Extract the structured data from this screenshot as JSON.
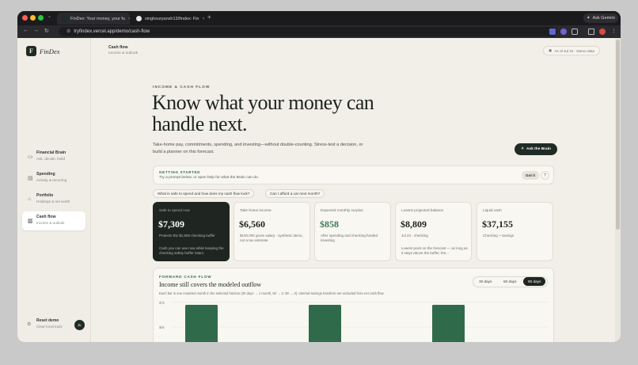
{
  "browser": {
    "tabs": [
      {
        "title": "FinDex: Your money, your fu",
        "active": true
      },
      {
        "title": "singhsuryansh13/findex: Fin",
        "active": false
      }
    ],
    "new_tab": "+",
    "ask_gemini": "Ask Gemini",
    "url": "tryfindex.vercel.app/demo/cash-flow"
  },
  "app": {
    "logo_letter": "F",
    "logo_name": "FinDex",
    "nav": [
      {
        "title": "Financial Brain",
        "subtitle": "Ask, decide, build",
        "icon": "briefcase-icon"
      },
      {
        "title": "Spending",
        "subtitle": "Activity & recurring",
        "icon": "receipt-icon"
      },
      {
        "title": "Portfolio",
        "subtitle": "Holdings & net worth",
        "icon": "bank-icon"
      },
      {
        "title": "Cash flow",
        "subtitle": "Income & outlook",
        "icon": "bar-chart-icon",
        "active": true
      }
    ],
    "reset": {
      "title": "Reset demo",
      "subtitle": "Clear local tools"
    },
    "avatar": "JL"
  },
  "header": {
    "title": "Cash flow",
    "subtitle": "Income & outlook",
    "as_of": "As of Jul 31 · Demo data"
  },
  "hero": {
    "eyebrow": "INCOME & CASH FLOW",
    "headline": "Know what your money can handle next.",
    "lede": "Take-home pay, commitments, spending, and investing—without double-counting. Stress-test a decision, or build a planner on this forecast.",
    "ask_brain": "Ask the Brain"
  },
  "getting_started": {
    "heading": "GETTING STARTED",
    "text": "Try a prompt below, or open help for what the Brain can do.",
    "got_it": "Got it",
    "help": "?"
  },
  "prompts": [
    "What is safe to spend and how does my cash flow look?",
    "Can I afford a car next month?"
  ],
  "cards": [
    {
      "label": "Safe to spend now",
      "value": "$7,309",
      "sub": "Protects the $1,500 checking buffer",
      "sub2": "Cash you can use now while keeping the checking safety buffer intact.",
      "dark": true
    },
    {
      "label": "Take-home income",
      "value": "$6,560",
      "sub": "$100,000 gross salary · synthetic demo, not a tax estimate",
      "sub2": ""
    },
    {
      "label": "Expected monthly surplus",
      "value": "$858",
      "sub": "After spending and checking-funded investing",
      "sub2": "",
      "green": true
    },
    {
      "label": "Lowest projected balance",
      "value": "$8,809",
      "sub": "Jul 24 · checking",
      "sub2": "Lowest point on the forecast — as long as it stays above the buffer, the..."
    },
    {
      "label": "Liquid cash",
      "value": "$37,155",
      "sub": "Checking + savings",
      "sub2": ""
    }
  ],
  "forward": {
    "heading": "FORWARD CASH FLOW",
    "title": "Income still covers the modeled outflow",
    "desc": "Each bar is one modeled month in the selected horizon (30 days → 1 month, 60 → 2, 90 → 3). Internal savings transfers are excluded from net cash flow.",
    "ranges": [
      "30 days",
      "60 days",
      "90 days"
    ],
    "active_range": "90 days"
  },
  "chart_data": {
    "type": "bar",
    "y_tick_labels": [
      "$7k",
      "$6k"
    ],
    "bar_color": "#2f6b4a",
    "bar_count": 3
  },
  "colors": {
    "accent": "#2f6b4a",
    "dark": "#1f2520",
    "page": "#f1efe8"
  }
}
